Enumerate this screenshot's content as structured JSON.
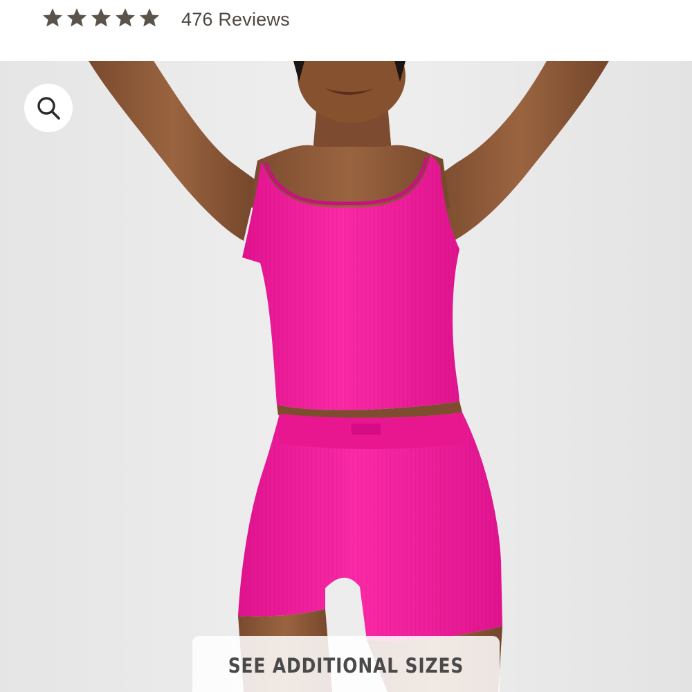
{
  "rating": {
    "stars_filled": 5,
    "stars_total": 5,
    "reviews_text": "476 Reviews",
    "star_color": "#5a534c"
  },
  "product_image": {
    "subject": "model wearing hot pink ribbed tank top and bike shorts",
    "garment_color": "#f520a0",
    "background_color": "#ececec"
  },
  "zoom_button": {
    "icon": "search-icon"
  },
  "sizes_button": {
    "label": "SEE ADDITIONAL SIZES"
  }
}
